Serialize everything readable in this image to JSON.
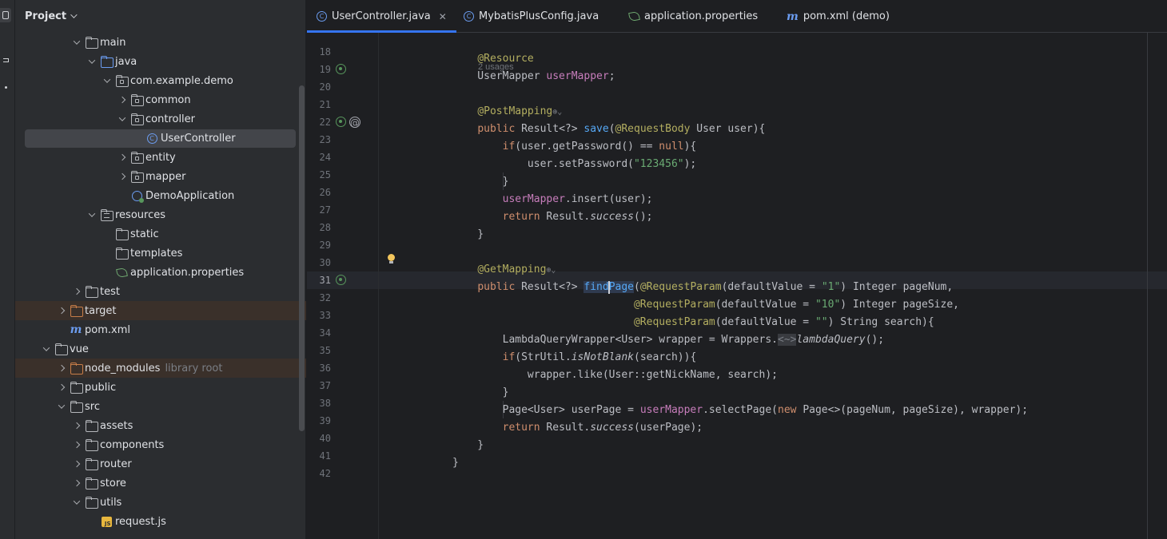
{
  "project": {
    "title": "Project",
    "tree": [
      {
        "label": "main",
        "icon": "folder",
        "arrow": "down",
        "indent": 1
      },
      {
        "label": "java",
        "icon": "folder-blue",
        "arrow": "down",
        "indent": 2
      },
      {
        "label": "com.example.demo",
        "icon": "package",
        "arrow": "down",
        "indent": 3
      },
      {
        "label": "common",
        "icon": "package",
        "arrow": "right",
        "indent": 4
      },
      {
        "label": "controller",
        "icon": "package",
        "arrow": "down",
        "indent": 4
      },
      {
        "label": "UserController",
        "icon": "class",
        "arrow": "none",
        "indent": 5,
        "selected": true
      },
      {
        "label": "entity",
        "icon": "package",
        "arrow": "right",
        "indent": 4
      },
      {
        "label": "mapper",
        "icon": "package",
        "arrow": "right",
        "indent": 4
      },
      {
        "label": "DemoApplication",
        "icon": "spring-app",
        "arrow": "none",
        "indent": 4
      },
      {
        "label": "resources",
        "icon": "resources",
        "arrow": "down",
        "indent": 2
      },
      {
        "label": "static",
        "icon": "folder",
        "arrow": "none",
        "indent": 3
      },
      {
        "label": "templates",
        "icon": "folder",
        "arrow": "none",
        "indent": 3
      },
      {
        "label": "application.properties",
        "icon": "spring-leaf",
        "arrow": "none",
        "indent": 3
      },
      {
        "label": "test",
        "icon": "folder",
        "arrow": "right",
        "indent": 1
      },
      {
        "label": "target",
        "icon": "folder-orange",
        "arrow": "right",
        "indent": 0,
        "highlight": true
      },
      {
        "label": "pom.xml",
        "icon": "maven",
        "arrow": "none",
        "indent": 0
      },
      {
        "label": "vue",
        "icon": "folder",
        "arrow": "down",
        "indent": -1
      },
      {
        "label": "node_modules",
        "hint": "library root",
        "icon": "folder-orange",
        "arrow": "right",
        "indent": 0,
        "highlight": true
      },
      {
        "label": "public",
        "icon": "folder",
        "arrow": "right",
        "indent": 0
      },
      {
        "label": "src",
        "icon": "folder",
        "arrow": "down",
        "indent": 0
      },
      {
        "label": "assets",
        "icon": "folder",
        "arrow": "right",
        "indent": 1
      },
      {
        "label": "components",
        "icon": "folder",
        "arrow": "right",
        "indent": 1
      },
      {
        "label": "router",
        "icon": "folder",
        "arrow": "right",
        "indent": 1
      },
      {
        "label": "store",
        "icon": "folder",
        "arrow": "right",
        "indent": 1
      },
      {
        "label": "utils",
        "icon": "folder",
        "arrow": "down",
        "indent": 1
      },
      {
        "label": "request.js",
        "icon": "js",
        "arrow": "none",
        "indent": 2
      }
    ]
  },
  "tabs": [
    {
      "label": "UserController.java",
      "icon": "class",
      "active": true,
      "closable": true
    },
    {
      "label": "MybatisPlusConfig.java",
      "icon": "class",
      "active": false
    },
    {
      "label": "application.properties",
      "icon": "spring-leaf",
      "active": false
    },
    {
      "label": "pom.xml (demo)",
      "icon": "maven",
      "active": false
    }
  ],
  "editor": {
    "usages_hint": "2 usages",
    "current_line": 31,
    "line_numbers": [
      "18",
      "19",
      "20",
      "21",
      "22",
      "23",
      "24",
      "25",
      "26",
      "27",
      "28",
      "29",
      "30",
      "31",
      "32",
      "33",
      "34",
      "35",
      "36",
      "37",
      "38",
      "39",
      "40",
      "41",
      "42"
    ]
  },
  "colors": {
    "accent": "#3574f0",
    "keyword": "#cf8e6d",
    "annotation": "#b3ae60",
    "function": "#56a8f5",
    "field": "#c77dbb",
    "string": "#6aab73"
  }
}
